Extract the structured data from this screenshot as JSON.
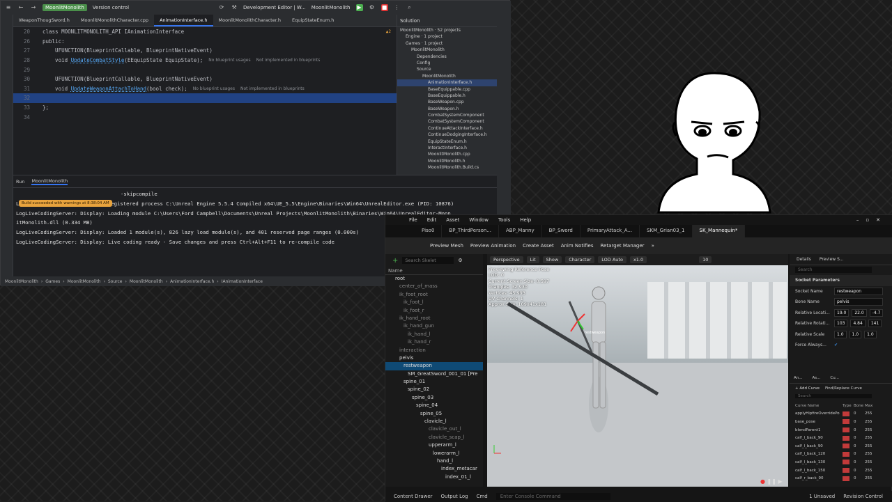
{
  "ide": {
    "title": {
      "project": "MoonlitMonolith",
      "vcs": "Version control",
      "config": "Development Editor | W...",
      "target": "MoonlitMonolith"
    },
    "tabs": [
      "WeaponThougSword.h",
      "MoonlitMonolithCharacter.cpp",
      "AnimationInterface.h",
      "MoonlitMonolithCharacter.h",
      "EquipStateEnum.h"
    ],
    "warnings": "▲2",
    "code": [
      {
        "num": "20",
        "a": "class MOONLITMONOLITH_API IAnimationInterface",
        "b": "",
        "c": "",
        "h1": "",
        "h2": ""
      },
      {
        "num": "26",
        "a": "public:",
        "b": "",
        "c": "",
        "h1": "",
        "h2": ""
      },
      {
        "num": "27",
        "a": "    UFUNCTION(BlueprintCallable, BlueprintNativeEvent)",
        "b": "",
        "c": "",
        "h1": "",
        "h2": ""
      },
      {
        "num": "28",
        "a": "    void ",
        "b": "UpdateCombatStyle",
        "c": "(EEquipState EquipState);",
        "h1": "No blueprint usages",
        "h2": "Not implemented in blueprints"
      },
      {
        "num": "29",
        "a": "",
        "b": "",
        "c": "",
        "h1": "",
        "h2": ""
      },
      {
        "num": "30",
        "a": "    UFUNCTION(BlueprintCallable, BlueprintNativeEvent)",
        "b": "",
        "c": "",
        "h1": "",
        "h2": ""
      },
      {
        "num": "31",
        "a": "    void ",
        "b": "UpdateWeaponAttachToHand",
        "c": "(bool check);",
        "h1": "No blueprint usages",
        "h2": "Not implemented in blueprints"
      },
      {
        "num": "32",
        "a": "",
        "b": "",
        "c": "",
        "h1": "",
        "h2": ""
      },
      {
        "num": "33",
        "a": "};",
        "b": "",
        "c": "",
        "h1": "",
        "h2": ""
      },
      {
        "num": "34",
        "a": "",
        "b": "",
        "c": "",
        "h1": "",
        "h2": ""
      }
    ],
    "solution": {
      "header": "Solution",
      "items": [
        {
          "label": "MoonlitMonolith · 52 projects",
          "indent": 0
        },
        {
          "label": "Engine · 1 project",
          "indent": 1
        },
        {
          "label": "Games · 1 project",
          "indent": 1
        },
        {
          "label": "MoonlitMonolith",
          "indent": 2
        },
        {
          "label": "Dependencies",
          "indent": 3
        },
        {
          "label": "Config",
          "indent": 3
        },
        {
          "label": "Source",
          "indent": 3
        },
        {
          "label": "MoonlitMonolith",
          "indent": 4
        },
        {
          "label": "AnimationInterface.h",
          "indent": 5
        },
        {
          "label": "BaseEquippable.cpp",
          "indent": 5
        },
        {
          "label": "BaseEquippable.h",
          "indent": 5
        },
        {
          "label": "BaseWeapon.cpp",
          "indent": 5
        },
        {
          "label": "BaseWeapon.h",
          "indent": 5
        },
        {
          "label": "CombatSystemComponent",
          "indent": 5
        },
        {
          "label": "CombatSystemComponent",
          "indent": 5
        },
        {
          "label": "ContinueAttackInterface.h",
          "indent": 5
        },
        {
          "label": "ContinueDodgingInterface.h",
          "indent": 5
        },
        {
          "label": "EquipStateEnum.h",
          "indent": 5
        },
        {
          "label": "InteractInterface.h",
          "indent": 5
        },
        {
          "label": "MoonlitMonolith.cpp",
          "indent": 5
        },
        {
          "label": "MoonlitMonolith.h",
          "indent": 5
        },
        {
          "label": "MoonlitMonolith.Build.cs",
          "indent": 5
        }
      ]
    },
    "run": {
      "tab1": "Run",
      "tab2": "MoonlitMonolith",
      "toast": "Build succeeded with warnings at 8:38:04 AM",
      "cmd_tail": "-skipcompile",
      "lines": [
        "LogLiveCodingServer: Display: Registered process C:\\Unreal Engine 5.5.4 Compiled x64\\UE_5.5\\Engine\\Binaries\\Win64\\UnrealEditor.exe (PID: 10876)",
        "LogLiveCodingServer: Display: Loading module C:\\Users\\Ford Campbell\\Documents\\Unreal Projects\\MoonlitMonolith\\Binaries\\Win64\\UnrealEditor-Moon",
        "itMonolith.dll (0.334 MB)",
        "LogLiveCodingServer: Display: Loaded 1 module(s), 826 lazy load module(s), and 401 reserved page ranges (0.000s)",
        "LogLiveCodingServer: Display: Live coding ready - Save changes and press Ctrl+Alt+F11 to re-compile code"
      ]
    },
    "breadcrumb": [
      "MoonlitMonolith",
      "Games",
      "MoonlitMonolith",
      "Source",
      "MoonlitMonolith",
      "AnimationInterface.h",
      "IAnimationInterface"
    ]
  },
  "ue": {
    "menu": [
      "File",
      "Edit",
      "Asset",
      "Window",
      "Tools",
      "Help"
    ],
    "tabs": [
      "Piso0",
      "BP_ThirdPerson...",
      "ABP_Manny",
      "BP_Sword",
      "PrimaryAttack_A...",
      "SKM_Grian03_1",
      "SK_Mannequin*"
    ],
    "toolbar": [
      "Preview Mesh",
      "Preview Animation",
      "Create Asset",
      "Anim Notifies",
      "Retarget Manager"
    ],
    "skeleton": {
      "search": "Search Skelet",
      "name_header": "Name",
      "bones": [
        {
          "label": "root",
          "indent": 0,
          "dim": false
        },
        {
          "label": "center_of_mass",
          "indent": 1,
          "dim": true
        },
        {
          "label": "ik_foot_root",
          "indent": 1,
          "dim": true
        },
        {
          "label": "ik_foot_l",
          "indent": 2,
          "dim": true
        },
        {
          "label": "ik_foot_r",
          "indent": 2,
          "dim": true
        },
        {
          "label": "ik_hand_root",
          "indent": 1,
          "dim": true
        },
        {
          "label": "ik_hand_gun",
          "indent": 2,
          "dim": true
        },
        {
          "label": "ik_hand_l",
          "indent": 3,
          "dim": true
        },
        {
          "label": "ik_hand_r",
          "indent": 3,
          "dim": true
        },
        {
          "label": "interaction",
          "indent": 1,
          "dim": true
        },
        {
          "label": "pelvis",
          "indent": 1,
          "dim": false
        },
        {
          "label": "restweapon",
          "indent": 2,
          "dim": false,
          "sel": true
        },
        {
          "label": "SM_GreatSword_001_01 [Pre",
          "indent": 3,
          "dim": false
        },
        {
          "label": "spine_01",
          "indent": 2,
          "dim": false
        },
        {
          "label": "spine_02",
          "indent": 3,
          "dim": false
        },
        {
          "label": "spine_03",
          "indent": 4,
          "dim": false
        },
        {
          "label": "spine_04",
          "indent": 5,
          "dim": false
        },
        {
          "label": "spine_05",
          "indent": 6,
          "dim": false
        },
        {
          "label": "clavicle_l",
          "indent": 7,
          "dim": false
        },
        {
          "label": "clavicle_out_l",
          "indent": 8,
          "dim": true
        },
        {
          "label": "clavicle_scap_l",
          "indent": 8,
          "dim": true
        },
        {
          "label": "upperarm_l",
          "indent": 8,
          "dim": false
        },
        {
          "label": "lowerarm_l",
          "indent": 9,
          "dim": false
        },
        {
          "label": "hand_l",
          "indent": 10,
          "dim": false
        },
        {
          "label": "index_metacar",
          "indent": 11,
          "dim": false
        },
        {
          "label": "index_01_l",
          "indent": 12,
          "dim": false
        }
      ]
    },
    "viewport": {
      "buttons": [
        "Perspective",
        "Lit",
        "Show",
        "Character",
        "LOD Auto",
        "x1.0"
      ],
      "grid": "10",
      "stats": [
        "Previewing Reference Pose",
        "LOD: 0",
        "Current Screen Size: 0.597",
        "Triangles: 32,930",
        "Vertices: 45,993",
        "UV Channels: 1",
        "Approx Size: 109x41x181"
      ],
      "socket_label": "restweapon"
    },
    "details": {
      "tab1": "Details",
      "tab2": "Preview S...",
      "search": "Search",
      "section": "Socket Parameters",
      "socket_name_label": "Socket Name",
      "socket_name": "restweapon",
      "bone_name_label": "Bone Name",
      "bone_name": "pelvis",
      "loc_label": "Relative Locati...",
      "loc": [
        "19.0",
        "22.0",
        "-4.7"
      ],
      "rot_label": "Relative Rotati...",
      "rot": [
        "103",
        "4.84",
        "141"
      ],
      "scale_label": "Relative Scale",
      "scale": [
        "1.0",
        "1.0",
        "1.0"
      ],
      "force_label": "Force Always..."
    },
    "curves": {
      "tabs": [
        "An...",
        "As...",
        "Cu..."
      ],
      "add": "+ Add Curve",
      "find": "Find/Replace Curve",
      "search": "Search",
      "headers": [
        "Curve Name",
        "Type",
        "Bone",
        "Max"
      ],
      "rows": [
        {
          "name": "applyHipfireOverridePo",
          "bone": "0",
          "max": "255"
        },
        {
          "name": "base_pose",
          "bone": "0",
          "max": "255"
        },
        {
          "name": "blendParent1",
          "bone": "0",
          "max": "255"
        },
        {
          "name": "calf_l_back_90",
          "bone": "0",
          "max": "255"
        },
        {
          "name": "calf_l_back_90",
          "bone": "0",
          "max": "255"
        },
        {
          "name": "calf_l_back_120",
          "bone": "0",
          "max": "255"
        },
        {
          "name": "calf_l_back_130",
          "bone": "0",
          "max": "255"
        },
        {
          "name": "calf_l_back_150",
          "bone": "0",
          "max": "255"
        },
        {
          "name": "calf_r_back_90",
          "bone": "0",
          "max": "255"
        }
      ]
    },
    "status": {
      "drawer": "Content Drawer",
      "log": "Output Log",
      "cmd": "Cmd",
      "console": "Enter Console Command",
      "unsaved": "1 Unsaved",
      "rc": "Revision Control"
    }
  }
}
